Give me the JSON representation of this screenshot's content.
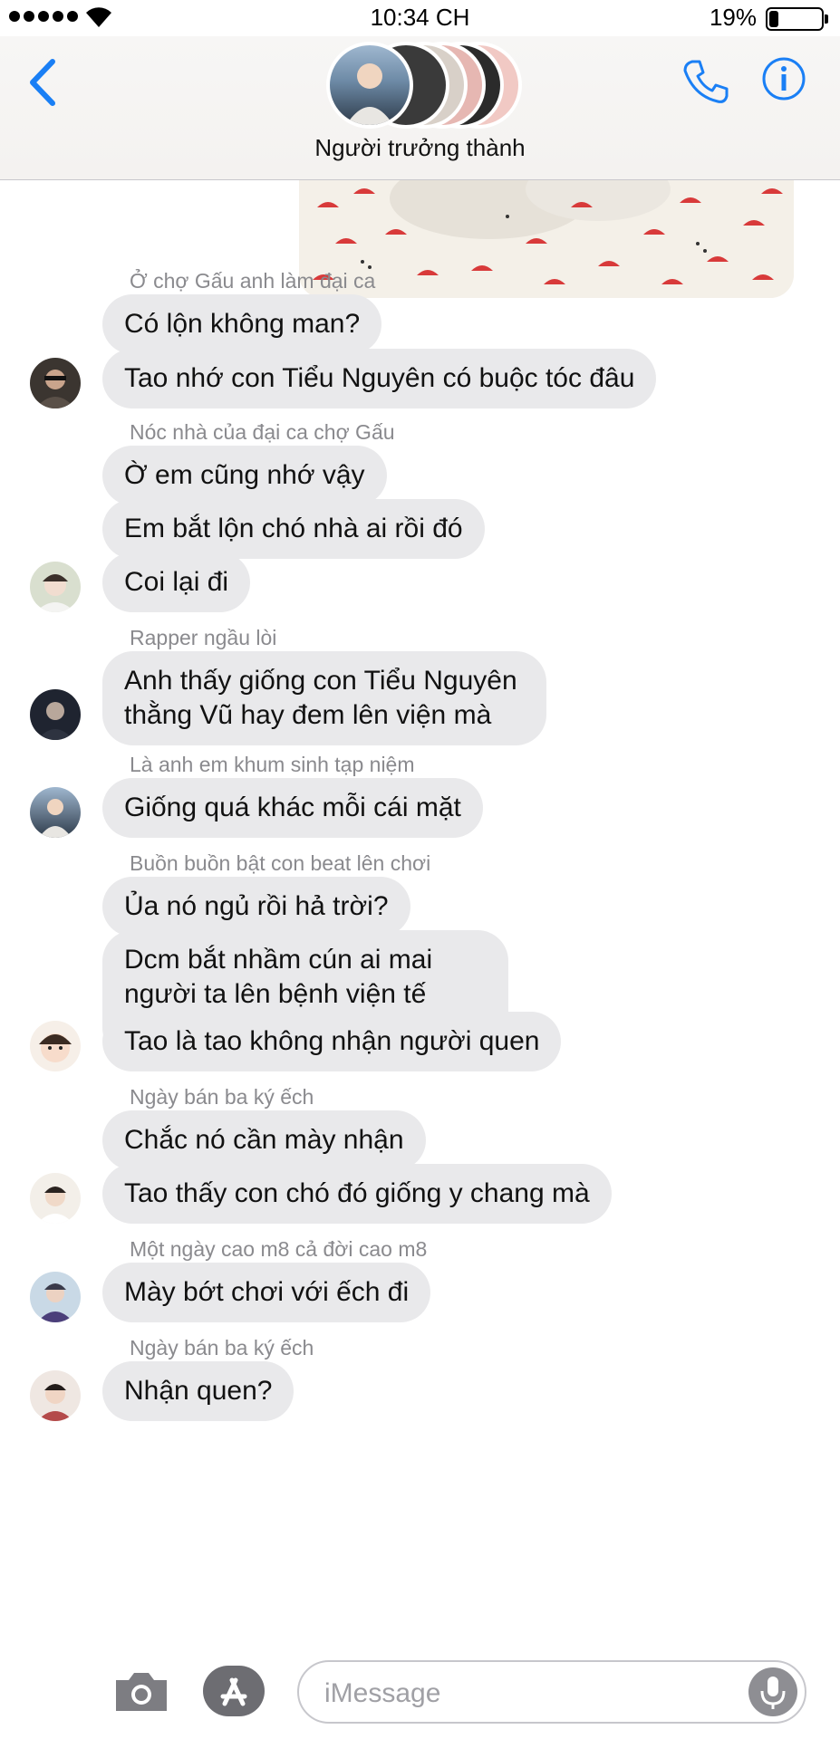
{
  "status_bar": {
    "time": "10:34 CH",
    "battery_pct": "19%",
    "battery_level": 0.19
  },
  "header": {
    "group_name": "Người trưởng thành",
    "back_icon": "chevron-left-icon",
    "call_icon": "phone-icon",
    "info_icon": "info-icon"
  },
  "messages": [
    {
      "sender": "Ở chợ Gấu anh làm đại ca",
      "texts": [
        "Có lộn không man?",
        "Tao nhớ con Tiểu Nguyên có buộc tóc đâu"
      ]
    },
    {
      "sender": "Nóc nhà của đại ca chợ Gấu",
      "texts": [
        "Ờ em cũng nhớ vậy",
        "Em bắt lộn chó nhà ai rồi đó",
        "Coi lại đi"
      ]
    },
    {
      "sender": "Rapper ngầu lòi",
      "texts": [
        "Anh thấy giống con Tiểu Nguyên thằng Vũ hay đem lên viện mà"
      ]
    },
    {
      "sender": "Là anh em khum sinh tạp niệm",
      "texts": [
        "Giống quá khác mỗi cái mặt"
      ]
    },
    {
      "sender": "Buồn buồn bật con beat lên chơi",
      "texts": [
        "Ủa nó ngủ rồi hả trời?",
        "Dcm bắt nhầm cún ai mai người ta lên bệnh viện tế sống cả lũ",
        "Tao là tao không nhận người quen"
      ]
    },
    {
      "sender": "Ngày bán ba ký ếch",
      "texts": [
        "Chắc nó cần mày nhận",
        "Tao thấy con chó đó giống y chang mà"
      ]
    },
    {
      "sender": "Một ngày cao m8 cả đời cao m8",
      "texts": [
        "Mày bớt chơi với ếch đi"
      ]
    },
    {
      "sender": "Ngày bán ba ký ếch",
      "texts": [
        "Nhận quen?"
      ]
    }
  ],
  "input": {
    "placeholder": "iMessage",
    "camera_icon": "camera-icon",
    "apps_icon": "app-store-icon",
    "mic_icon": "microphone-icon"
  },
  "colors": {
    "accent": "#1a7ff5",
    "bubble": "#e9e9eb",
    "sender_label": "#8a8a8e"
  }
}
